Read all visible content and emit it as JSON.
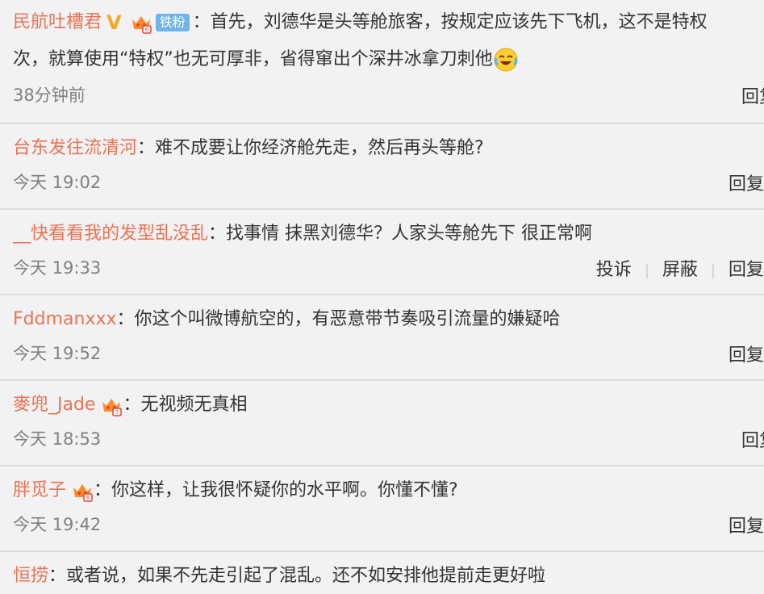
{
  "comments": [
    {
      "user": "民航吐槽君",
      "text_line1": "首先，刘德华是头等舱旅客，按规定应该先下飞机，这不是特权",
      "text_line2": "次，就算使用“特权”也无可厚非，省得窜出个深井冰拿刀刺他",
      "badge_fan": "铁粉",
      "time": "38分钟前",
      "reply": "回复"
    },
    {
      "user": "台东发往流清河",
      "text": "难不成要让你经济舱先走，然后再头等舱?",
      "time": "今天 19:02",
      "reply": "回复"
    },
    {
      "user": "__快看看我的发型乱没乱",
      "text": "找事情 抹黑刘德华？人家头等舱先下 很正常啊",
      "time": "今天 19:33",
      "report": "投诉",
      "block": "屏蔽",
      "reply": "回复"
    },
    {
      "user": "Fddmanxxx",
      "text": "你这个叫微博航空的，有恶意带节奏吸引流量的嫌疑哈",
      "time": "今天 19:52",
      "reply": "回复"
    },
    {
      "user": "麥兜_Jade",
      "text": "无视频无真相",
      "time": "今天 18:53",
      "reply": "回复"
    },
    {
      "user": "胖觅子",
      "text": "你这样，让我很怀疑你的水平啊。你懂不懂?",
      "time": "今天 19:42",
      "reply": "回复"
    },
    {
      "user": "恒捞",
      "text": "或者说，如果不先走引起了混乱。还不如安排他提前走更好啦"
    }
  ],
  "colon": "："
}
